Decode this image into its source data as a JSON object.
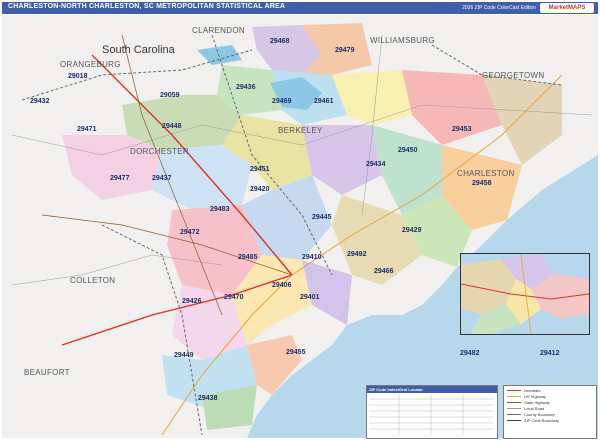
{
  "title": "CHARLESTON-NORTH CHARLESTON, SC METROPOLITAN STATISTICAL AREA",
  "edition": "2026 ZIP Code ColorCast Edition",
  "brand": "MarketMAPS",
  "state_label": "South Carolina",
  "counties": [
    {
      "name": "CLARENDON"
    },
    {
      "name": "WILLIAMSBURG"
    },
    {
      "name": "ORANGEBURG"
    },
    {
      "name": "GEORGETOWN"
    },
    {
      "name": "BERKELEY"
    },
    {
      "name": "DORCHESTER"
    },
    {
      "name": "CHARLESTON"
    },
    {
      "name": "COLLETON"
    },
    {
      "name": "BEAUFORT"
    }
  ],
  "zip_codes": [
    "29468",
    "29479",
    "29018",
    "29059",
    "29436",
    "29469",
    "29461",
    "29432",
    "29448",
    "29471",
    "29453",
    "29450",
    "29434",
    "29477",
    "29437",
    "29458",
    "29420",
    "29483",
    "29445",
    "29472",
    "29429",
    "29485",
    "29410",
    "29492",
    "29466",
    "29470",
    "29406",
    "29426",
    "29449",
    "29455",
    "29438",
    "29412",
    "29401",
    "29482",
    "29451"
  ],
  "locator": {
    "title": "ZIP Code Index/Grid Locator"
  },
  "legend": {
    "items": [
      {
        "label": "Interstate",
        "color": "#d8342b"
      },
      {
        "label": "US Highway",
        "color": "#e8a33b"
      },
      {
        "label": "State Highway",
        "color": "#8a5a2b"
      },
      {
        "label": "Local Road",
        "color": "#999999"
      },
      {
        "label": "County Boundary",
        "color": "#6a6a6a"
      },
      {
        "label": "ZIP Code Boundary",
        "color": "#444444"
      }
    ]
  },
  "colors": {
    "water": "#b7d7ec",
    "land_bg": "#f1f0ee",
    "title_bar": "#3f5fa8"
  }
}
